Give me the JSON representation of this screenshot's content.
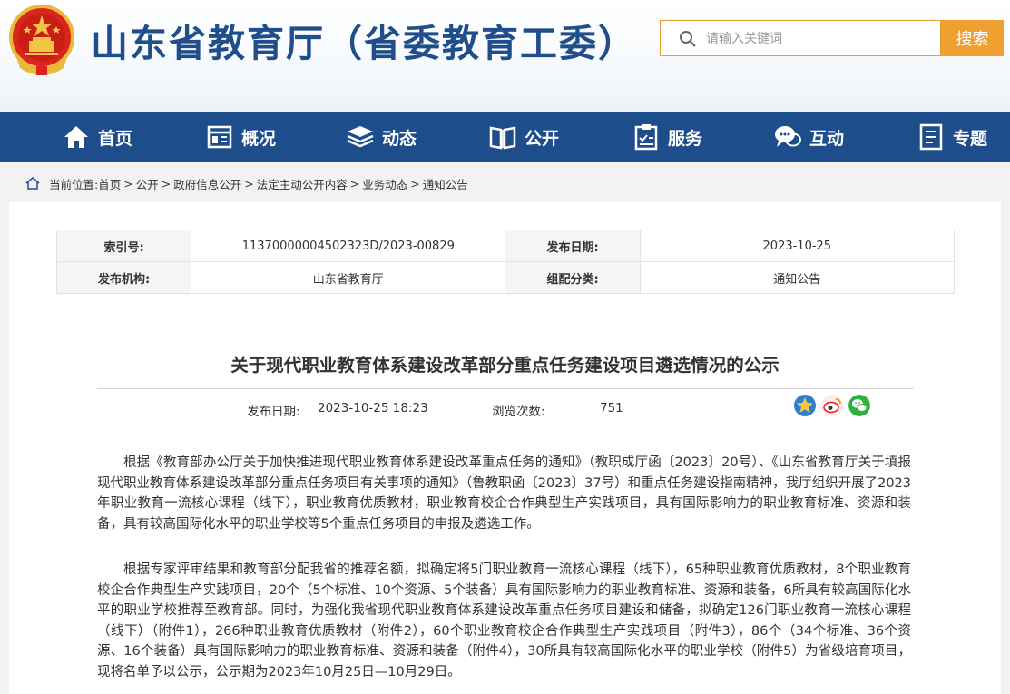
{
  "site": {
    "title": "山东省教育厅（省委教育工委）"
  },
  "search": {
    "placeholder": "请输入关键词",
    "button_label": "搜索"
  },
  "nav": {
    "items": [
      {
        "label": "首页",
        "icon": "home-icon"
      },
      {
        "label": "概况",
        "icon": "overview-icon"
      },
      {
        "label": "动态",
        "icon": "stack-icon"
      },
      {
        "label": "公开",
        "icon": "book-icon"
      },
      {
        "label": "服务",
        "icon": "clipboard-icon"
      },
      {
        "label": "互动",
        "icon": "chat-icon"
      },
      {
        "label": "专题",
        "icon": "document-icon"
      }
    ]
  },
  "breadcrumb": {
    "prefix": "当前位置:",
    "items": [
      "首页",
      "公开",
      "政府信息公开",
      "法定主动公开内容",
      "业务动态",
      "通知公告"
    ],
    "separator": ">"
  },
  "meta": {
    "index_label": "索引号:",
    "index_value": "11370000004502323D/2023-00829",
    "date_label": "发布日期:",
    "date_value": "2023-10-25",
    "org_label": "发布机构:",
    "org_value": "山东省教育厅",
    "category_label": "组配分类:",
    "category_value": "通知公告"
  },
  "article": {
    "title": "关于现代职业教育体系建设改革部分重点任务建设项目遴选情况的公示",
    "publish_label": "发布日期:",
    "publish_value": "2023-10-25 18:23",
    "views_label": "浏览次数:",
    "views_value": "751",
    "share_icons": [
      "favorite-star-icon",
      "weibo-icon",
      "wechat-icon"
    ],
    "paragraphs": [
      "根据《教育部办公厅关于加快推进现代职业教育体系建设改革重点任务的通知》（教职成厅函〔2023〕20号）、《山东省教育厅关于填报现代职业教育体系建设改革部分重点任务项目有关事项的通知》（鲁教职函〔2023〕37号）和重点任务建设指南精神，我厅组织开展了2023年职业教育一流核心课程（线下），职业教育优质教材，职业教育校企合作典型生产实践项目，具有国际影响力的职业教育标准、资源和装备，具有较高国际化水平的职业学校等5个重点任务项目的申报及遴选工作。",
      "根据专家评审结果和教育部分配我省的推荐名额，拟确定将5门职业教育一流核心课程（线下），65种职业教育优质教材，8个职业教育校企合作典型生产实践项目，20个（5个标准、10个资源、5个装备）具有国际影响力的职业教育标准、资源和装备，6所具有较高国际化水平的职业学校推荐至教育部。同时，为强化我省现代职业教育体系建设改革重点任务项目建设和储备，拟确定126门职业教育一流核心课程（线下）（附件1），266种职业教育优质教材（附件2），60个职业教育校企合作典型生产实践项目（附件3），86个（34个标准、36个资源、16个装备）具有国际影响力的职业教育标准、资源和装备（附件4），30所具有较高国际化水平的职业学校（附件5）为省级培育项目，现将名单予以公示，公示期为2023年10月25日—10月29日。"
    ]
  },
  "colors": {
    "nav_bg": "#1e4d8c",
    "title_blue": "#1f4e8a",
    "search_button": "#f0a030"
  }
}
